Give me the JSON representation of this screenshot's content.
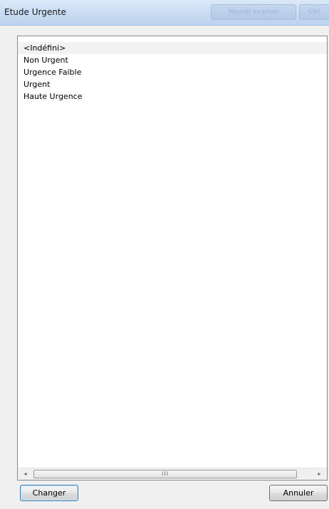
{
  "window": {
    "title": "Etude Urgente",
    "titlebar_buttons": [
      "Nouvel examen",
      "Ctrl"
    ]
  },
  "list": {
    "selected_index": 0,
    "items": [
      "<Indéfini>",
      "Non Urgent",
      "Urgence Faible",
      "Urgent",
      "Haute Urgence"
    ]
  },
  "scrollbar": {
    "left_arrow": "◂",
    "right_arrow": "▸",
    "grip": "III"
  },
  "buttons": {
    "change_label": "Changer",
    "cancel_label": "Annuler"
  }
}
